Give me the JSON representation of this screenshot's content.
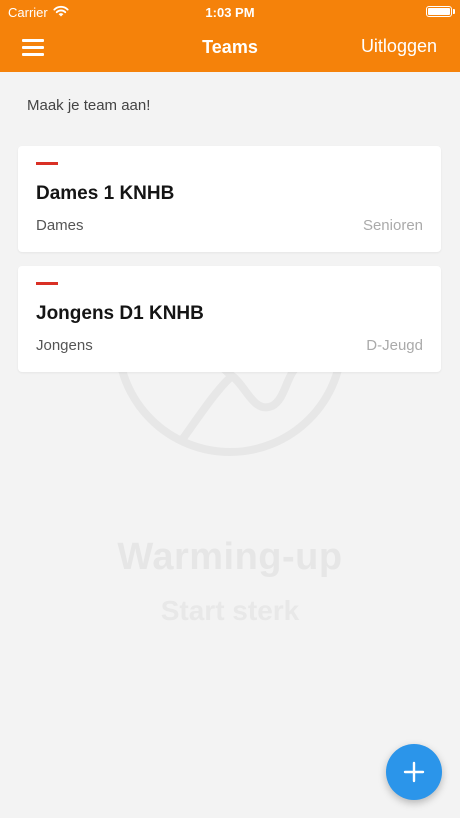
{
  "status_bar": {
    "carrier": "Carrier",
    "time": "1:03 PM"
  },
  "nav": {
    "title": "Teams",
    "logout_label": "Uitloggen"
  },
  "create_team_label": "Maak je team aan!",
  "teams": [
    {
      "name": "Dames 1 KNHB",
      "gender": "Dames",
      "category": "Senioren"
    },
    {
      "name": "Jongens D1 KNHB",
      "gender": "Jongens",
      "category": "D-Jeugd"
    }
  ],
  "watermark": {
    "title": "Warming-up",
    "subtitle": "Start sterk"
  },
  "colors": {
    "header": "#f5820a",
    "accent": "#d93025",
    "fab": "#2b95ea",
    "background": "#f3f3f3"
  },
  "icons": {
    "menu": "hamburger-menu-icon",
    "wifi": "wifi-icon",
    "battery": "battery-icon",
    "add": "plus-icon",
    "watermark": "warm-up-figure-icon"
  }
}
